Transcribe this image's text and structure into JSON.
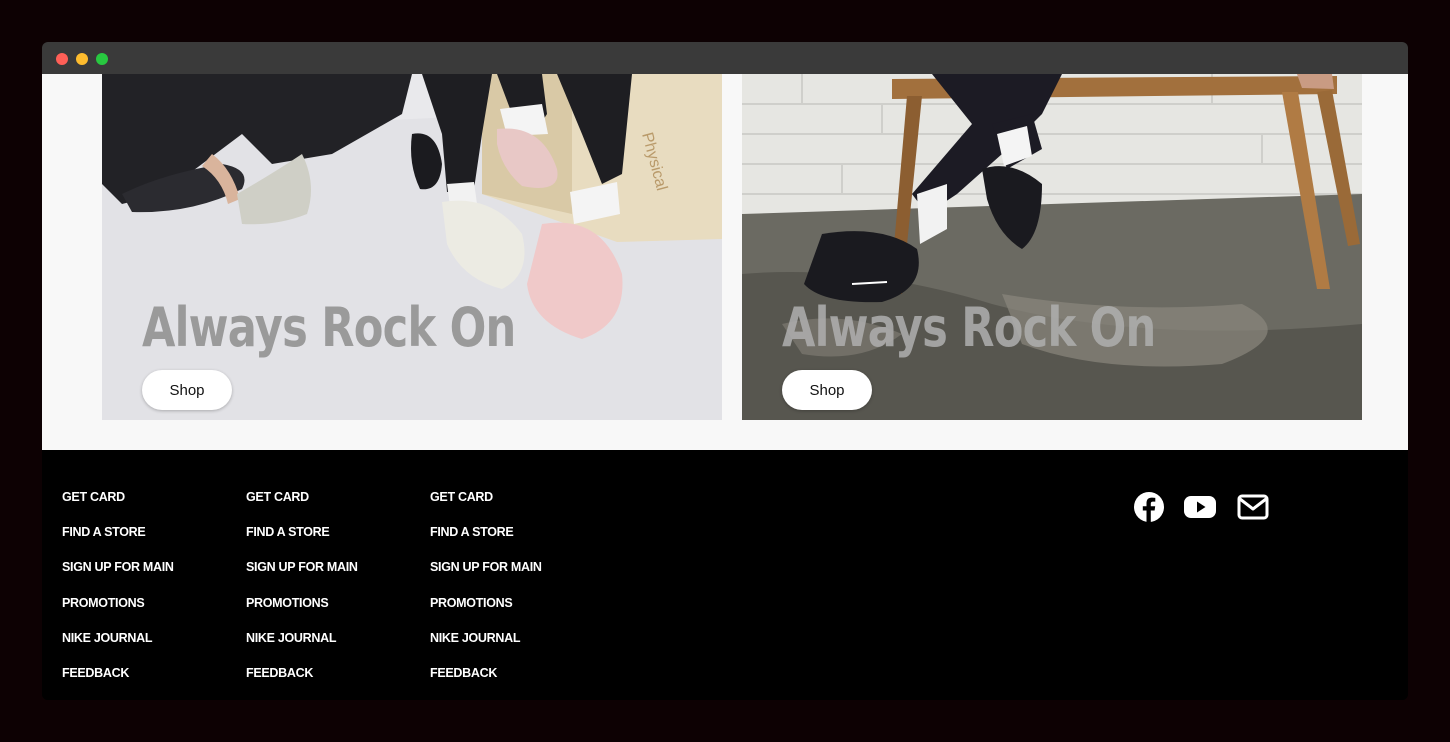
{
  "hero": {
    "cards": [
      {
        "headline": "Always Rock On",
        "button_label": "Shop"
      },
      {
        "headline": "Always Rock On",
        "button_label": "Shop"
      }
    ]
  },
  "footer": {
    "columns": [
      {
        "links": [
          "GET CARD",
          "FIND A STORE",
          "SIGN UP FOR MAIN",
          "PROMOTIONS",
          "NIKE JOURNAL",
          "FEEDBACK"
        ]
      },
      {
        "links": [
          "GET CARD",
          "FIND A STORE",
          "SIGN UP FOR MAIN",
          "PROMOTIONS",
          "NIKE JOURNAL",
          "FEEDBACK"
        ]
      },
      {
        "links": [
          "GET CARD",
          "FIND A STORE",
          "SIGN UP FOR MAIN",
          "PROMOTIONS",
          "NIKE JOURNAL",
          "FEEDBACK"
        ]
      }
    ],
    "social_icons": [
      "facebook-icon",
      "youtube-icon",
      "mail-icon"
    ]
  },
  "colors": {
    "page_background": "#0d0103",
    "content_background": "#f8f8f8",
    "footer_background": "#000000",
    "headline_color": "#9a9a9a"
  }
}
